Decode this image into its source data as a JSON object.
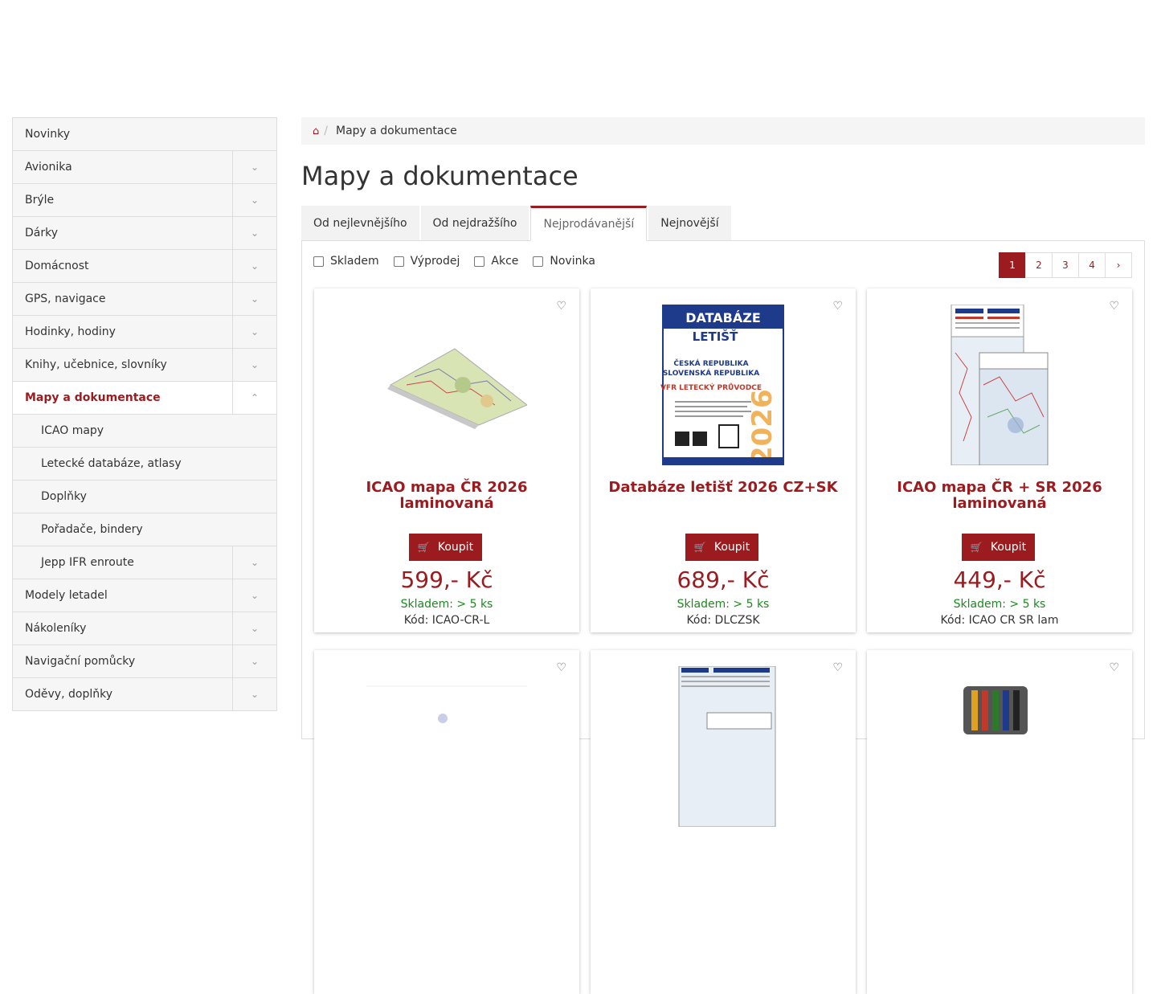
{
  "sidebar": {
    "categories": [
      {
        "label": "Novinky",
        "toggle": false,
        "sub": false,
        "active": false
      },
      {
        "label": "Avionika",
        "toggle": true,
        "sub": false,
        "active": false
      },
      {
        "label": "Brýle",
        "toggle": true,
        "sub": false,
        "active": false
      },
      {
        "label": "Dárky",
        "toggle": true,
        "sub": false,
        "active": false
      },
      {
        "label": "Domácnost",
        "toggle": true,
        "sub": false,
        "active": false
      },
      {
        "label": "GPS, navigace",
        "toggle": true,
        "sub": false,
        "active": false
      },
      {
        "label": "Hodinky, hodiny",
        "toggle": true,
        "sub": false,
        "active": false
      },
      {
        "label": "Knihy, učebnice, slovníky",
        "toggle": true,
        "sub": false,
        "active": false
      },
      {
        "label": "Mapy a dokumentace",
        "toggle": true,
        "sub": false,
        "active": true
      },
      {
        "label": "ICAO mapy",
        "toggle": false,
        "sub": true,
        "active": false
      },
      {
        "label": "Letecké databáze, atlasy",
        "toggle": false,
        "sub": true,
        "active": false
      },
      {
        "label": "Doplňky",
        "toggle": false,
        "sub": true,
        "active": false
      },
      {
        "label": "Pořadače, bindery",
        "toggle": false,
        "sub": true,
        "active": false
      },
      {
        "label": "Jepp IFR enroute",
        "toggle": true,
        "sub": true,
        "active": false
      },
      {
        "label": "Modely letadel",
        "toggle": true,
        "sub": false,
        "active": false
      },
      {
        "label": "Nákoleníky",
        "toggle": true,
        "sub": false,
        "active": false
      },
      {
        "label": "Navigační pomůcky",
        "toggle": true,
        "sub": false,
        "active": false
      },
      {
        "label": "Oděvy, doplňky",
        "toggle": true,
        "sub": false,
        "active": false
      }
    ]
  },
  "breadcrumb": {
    "current": "Mapy a dokumentace",
    "separator": "/"
  },
  "page": {
    "title": "Mapy a dokumentace"
  },
  "sort_tabs": [
    {
      "label": "Od nejlevnějšího",
      "active": false
    },
    {
      "label": "Od nejdražšího",
      "active": false
    },
    {
      "label": "Nejprodávanější",
      "active": true
    },
    {
      "label": "Nejnovější",
      "active": false
    }
  ],
  "filters": [
    "Skladem",
    "Výprodej",
    "Akce",
    "Novinka"
  ],
  "pagination": {
    "pages": [
      "1",
      "2",
      "3",
      "4"
    ],
    "current": "1"
  },
  "products": [
    {
      "title": "ICAO mapa ČR 2026 laminovaná",
      "buy_label": "Koupit",
      "price": "599,- Kč",
      "stock": "Skladem: > 5 ks",
      "code": "Kód: ICAO-CR-L"
    },
    {
      "title": "Databáze letišť 2026 CZ+SK",
      "buy_label": "Koupit",
      "price": "689,- Kč",
      "stock": "Skladem: > 5 ks",
      "code": "Kód: DLCZSK"
    },
    {
      "title": "ICAO mapa ČR + SR 2026 laminovaná",
      "buy_label": "Koupit",
      "price": "449,- Kč",
      "stock": "Skladem: > 5 ks",
      "code": "Kód: ICAO CR SR lam"
    }
  ],
  "book_cover": {
    "line1": "DATABÁZE",
    "line2": "LETIŠŤ",
    "line3": "ČESKÁ REPUBLIKA",
    "line4": "SLOVENSKÁ REPUBLIKA",
    "line5": "VFR LETECKÝ PRŮVODCE",
    "year": "2026"
  },
  "colors": {
    "accent": "#9b1b1f",
    "stock": "#1a8a1a",
    "border": "#dddddd"
  }
}
